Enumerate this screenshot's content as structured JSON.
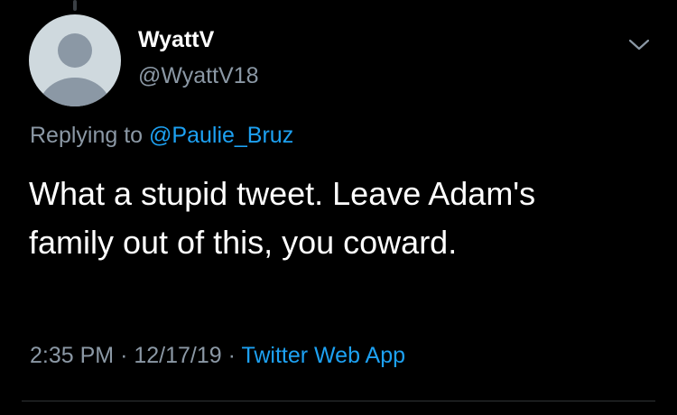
{
  "colors": {
    "background": "#000000",
    "primary_text": "#ffffff",
    "secondary_text": "#8b98a5",
    "accent": "#1da1f2",
    "avatar_bg": "#cfd9de",
    "avatar_silhouette": "#8b98a5"
  },
  "tweet": {
    "author": {
      "display_name": "WyattV",
      "handle": "@WyattV18",
      "avatar_icon": "default-profile-silhouette-icon"
    },
    "menu_icon": "chevron-down-icon",
    "reply_context": {
      "prefix": "Replying to",
      "mention": "@Paulie_Bruz"
    },
    "text_lines": [
      "What a stupid tweet. Leave Adam's",
      "family out of this, you coward."
    ],
    "meta": {
      "time": "2:35 PM",
      "date": "12/17/19",
      "separator": "·",
      "source": "Twitter Web App"
    }
  }
}
